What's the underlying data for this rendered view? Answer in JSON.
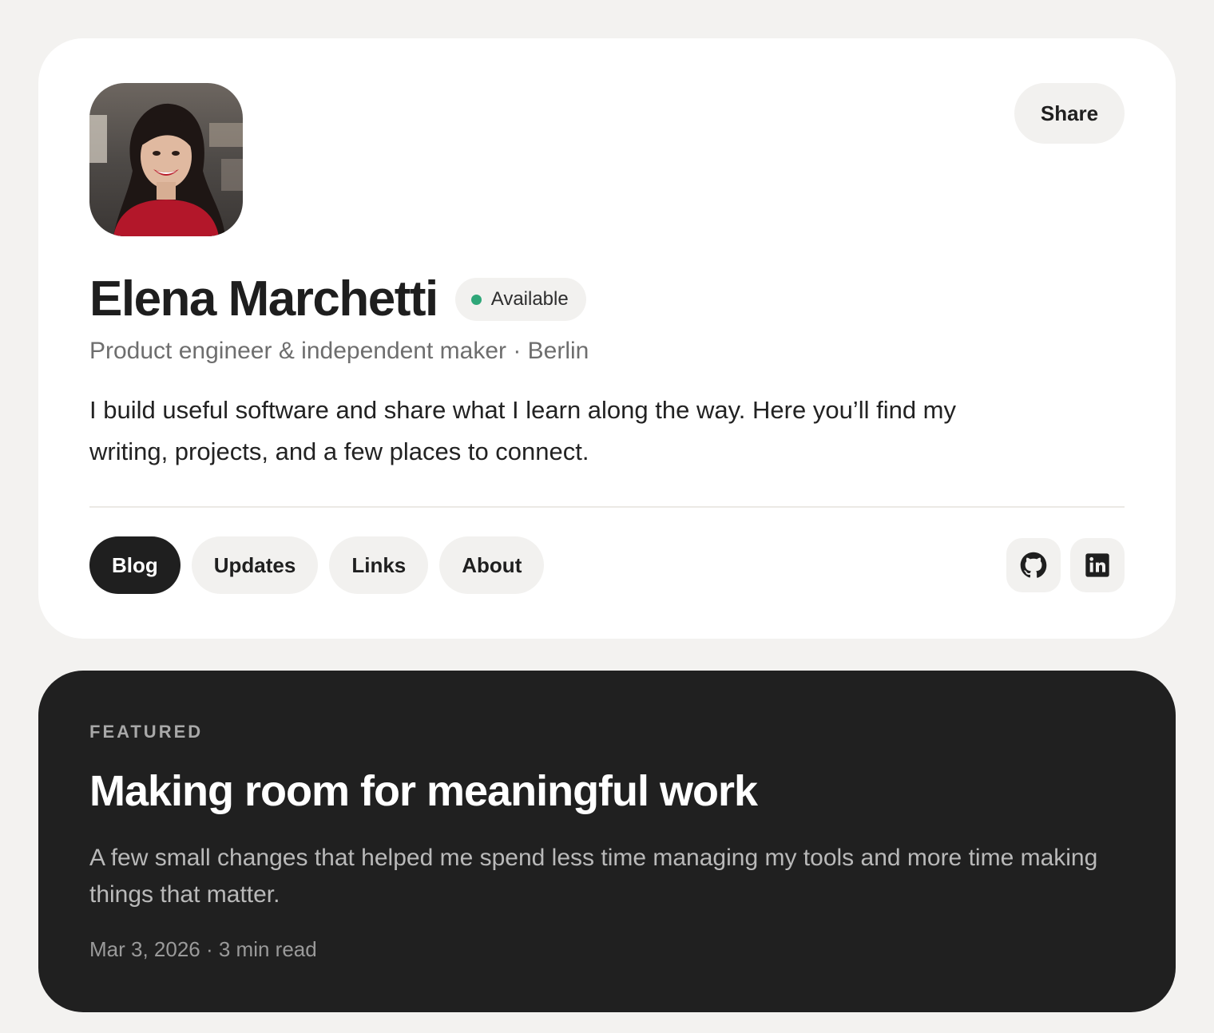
{
  "profile": {
    "name": "Elena Marchetti",
    "status": "Available",
    "status_color": "#2fa779",
    "subtitle": "Product engineer & independent maker · Berlin",
    "bio": "I build useful software and share what I learn along the way. Here you’ll find my writing, projects, and a few places to connect.",
    "share_label": "Share",
    "avatar_icon": "portrait-photo"
  },
  "tabs": [
    {
      "label": "Blog",
      "active": true
    },
    {
      "label": "Updates",
      "active": false
    },
    {
      "label": "Links",
      "active": false
    },
    {
      "label": "About",
      "active": false
    }
  ],
  "socials": [
    {
      "icon": "github-icon"
    },
    {
      "icon": "linkedin-icon"
    }
  ],
  "featured": {
    "label": "FEATURED",
    "title": "Making room for meaningful work",
    "description": "A few small changes that helped me spend less time managing my tools and more time making things that matter.",
    "meta": "Mar 3, 2026 · 3 min read"
  },
  "colors": {
    "page_bg": "#f3f2f0",
    "card_bg": "#ffffff",
    "featured_bg": "#202020",
    "active_tab_bg": "#1f1f1f"
  }
}
